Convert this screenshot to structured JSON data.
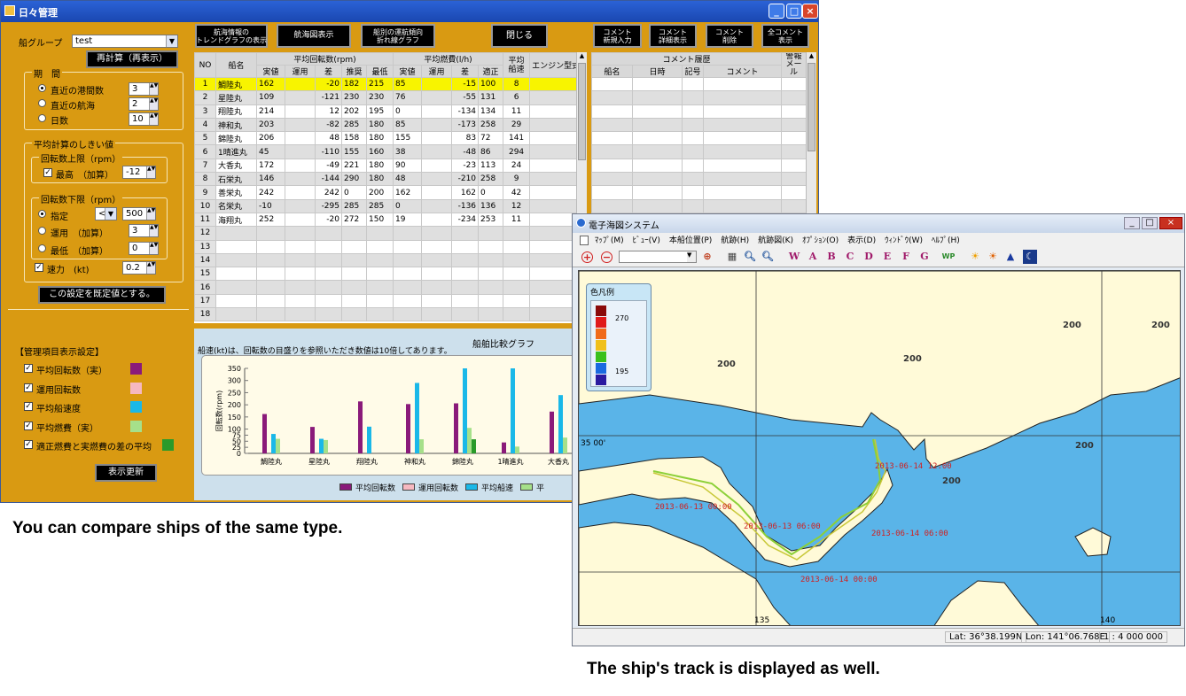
{
  "win1": {
    "title": "日々管理"
  },
  "left": {
    "ship_group_label": "船グループ",
    "ship_group_value": "test",
    "recalc": "再計算（再表示）",
    "period": {
      "title": "期　間",
      "options": [
        "直近の港間数",
        "直近の航海",
        "日数"
      ],
      "values": [
        "3",
        "2",
        "10"
      ]
    },
    "threshold": {
      "title": "平均計算のしきい値",
      "upper_title": "回転数上限（rpm）",
      "upper_opt": "最高　（加算）",
      "upper_val": "-12",
      "lower_title": "回転数下限（rpm）",
      "lower_opts": [
        "指定",
        "運用　（加算）",
        "最低　（加算）"
      ],
      "lower_cmp": "<",
      "lower_vals": [
        "500",
        "3",
        "0"
      ],
      "speed_label": "速力　(kt)",
      "speed_val": "0.2"
    },
    "default_btn": "この設定を既定値とする。",
    "display": {
      "title": "【管理項目表示設定】",
      "items": [
        "平均回転数（実）",
        "運用回転数",
        "平均船速度",
        "平均燃費（実）",
        "適正燃費と実燃費の差の平均"
      ],
      "colors": [
        "#8a1a7a",
        "#f6b8c0",
        "#1ab8e8",
        "#a6e08a",
        "#2a9a2a"
      ]
    },
    "refresh_btn": "表示更新"
  },
  "toolbar": {
    "b1": "航海情報の\nトレンドグラフの表示",
    "b2": "航海図表示",
    "b3": "船別の運航傾向\n折れ線グラフ",
    "b4": "閉じる",
    "b5": "コメント\n新規入力",
    "b6": "コメント\n詳細表示",
    "b7": "コメント\n削除",
    "b8": "全コメント\n表示"
  },
  "grid": {
    "h1": [
      "NO",
      "船名",
      "平均回転数(rpm)",
      "平均燃費(l/h)",
      "平均\n船速",
      "エンジン型式"
    ],
    "h2": [
      "実値",
      "運用",
      "差",
      "推奨",
      "最低",
      "実値",
      "運用",
      "差",
      "適正"
    ],
    "rows": [
      [
        "1",
        "鯛陸丸",
        "162",
        "",
        "-20",
        "182",
        "215",
        "85",
        "",
        "-15",
        "100",
        "8"
      ],
      [
        "2",
        "星陸丸",
        "109",
        "",
        "-121",
        "230",
        "230",
        "76",
        "",
        "-55",
        "131",
        "6"
      ],
      [
        "3",
        "翔陸丸",
        "214",
        "",
        "12",
        "202",
        "195",
        "0",
        "",
        "-134",
        "134",
        "11"
      ],
      [
        "4",
        "神和丸",
        "203",
        "",
        "-82",
        "285",
        "180",
        "85",
        "",
        "-173",
        "258",
        "29"
      ],
      [
        "5",
        "錦陸丸",
        "206",
        "",
        "48",
        "158",
        "180",
        "155",
        "",
        "83",
        "72",
        "141"
      ],
      [
        "6",
        "1晴進丸",
        "45",
        "",
        "-110",
        "155",
        "160",
        "38",
        "",
        "-48",
        "86",
        "294"
      ],
      [
        "7",
        "大香丸",
        "172",
        "",
        "-49",
        "221",
        "180",
        "90",
        "",
        "-23",
        "113",
        "24"
      ],
      [
        "8",
        "石栄丸",
        "146",
        "",
        "-144",
        "290",
        "180",
        "48",
        "",
        "-210",
        "258",
        "9"
      ],
      [
        "9",
        "善栄丸",
        "242",
        "",
        "242",
        "0",
        "200",
        "162",
        "",
        "162",
        "0",
        "42"
      ],
      [
        "10",
        "名栄丸",
        "-10",
        "",
        "-295",
        "285",
        "285",
        "0",
        "",
        "-136",
        "136",
        "12"
      ],
      [
        "11",
        "海翔丸",
        "252",
        "",
        "-20",
        "272",
        "150",
        "19",
        "",
        "-234",
        "253",
        "11"
      ],
      [
        "12"
      ],
      [
        "13"
      ],
      [
        "14"
      ],
      [
        "15"
      ],
      [
        "16"
      ],
      [
        "17"
      ],
      [
        "18"
      ]
    ]
  },
  "comment": {
    "title": "コメント履歴",
    "cols": [
      "船名",
      "日時",
      "記号",
      "コメント"
    ],
    "alarm": "警報\nメール"
  },
  "chart_data": {
    "type": "bar",
    "title": "船舶比較グラフ",
    "note": "船速(kt)は、回転数の目盛りを参照いただき数値は10倍してあります。",
    "ylabel": "回転数(rpm)",
    "ylim": [
      0,
      350
    ],
    "yticks": [
      0,
      25,
      50,
      75,
      100,
      150,
      200,
      250,
      300,
      350
    ],
    "categories": [
      "鯛陸丸",
      "星陸丸",
      "翔陸丸",
      "神和丸",
      "錦陸丸",
      "1晴進丸",
      "大香丸"
    ],
    "series": [
      {
        "name": "平均回転数",
        "color": "#8a1a7a",
        "values": [
          162,
          109,
          214,
          203,
          206,
          45,
          172
        ]
      },
      {
        "name": "運用回転数",
        "color": "#f6b8c0",
        "values": [
          0,
          0,
          0,
          0,
          0,
          0,
          0
        ]
      },
      {
        "name": "平均船速",
        "color": "#1ab8e8",
        "values": [
          80,
          60,
          110,
          290,
          350,
          350,
          240
        ]
      },
      {
        "name": "平",
        "color": "#a6e08a",
        "values": [
          60,
          55,
          0,
          58,
          105,
          28,
          65
        ]
      },
      {
        "name": "",
        "color": "#2a9a2a",
        "values": [
          0,
          0,
          0,
          0,
          58,
          0,
          0
        ]
      }
    ]
  },
  "map": {
    "title": "電子海図システム",
    "menu": [
      "ﾏｯﾌﾟ(M)",
      "ﾋﾞｭｰ(V)",
      "本船位置(P)",
      "航跡(H)",
      "航跡図(K)",
      "ｵﾌﾟｼｮﾝ(O)",
      "表示(D)",
      "ｳｨﾝﾄﾞｳ(W)",
      "ﾍﾙﾌﾟ(H)"
    ],
    "letters": [
      "W",
      "A",
      "B",
      "C",
      "D",
      "E",
      "F",
      "G"
    ],
    "legend_title": "色凡例",
    "legend_hi": "270",
    "legend_lo": "195",
    "legend_colors": [
      "#8a0a0a",
      "#e01a1a",
      "#f06a1a",
      "#f0c01a",
      "#3ac01a",
      "#1a6ae0",
      "#2a1aa0"
    ],
    "depth": [
      "200",
      "200",
      "200",
      "200",
      "200",
      "200"
    ],
    "lat_label": "35 00'",
    "lon_labels": [
      "135",
      "140"
    ],
    "tracks": [
      "2013-06-14 12:00",
      "2013-06-13 00:00",
      "2013-06-13 06:00",
      "2013-06-14 06:00",
      "2013-06-14 00:00"
    ],
    "status": {
      "lat": "Lat: 36°38.199N",
      "lon": "Lon: 141°06.768E",
      "scale": "1 : 4 000 000"
    }
  },
  "captions": {
    "left": "You can compare ships of the same type.",
    "right": "The ship's track is displayed as well."
  }
}
